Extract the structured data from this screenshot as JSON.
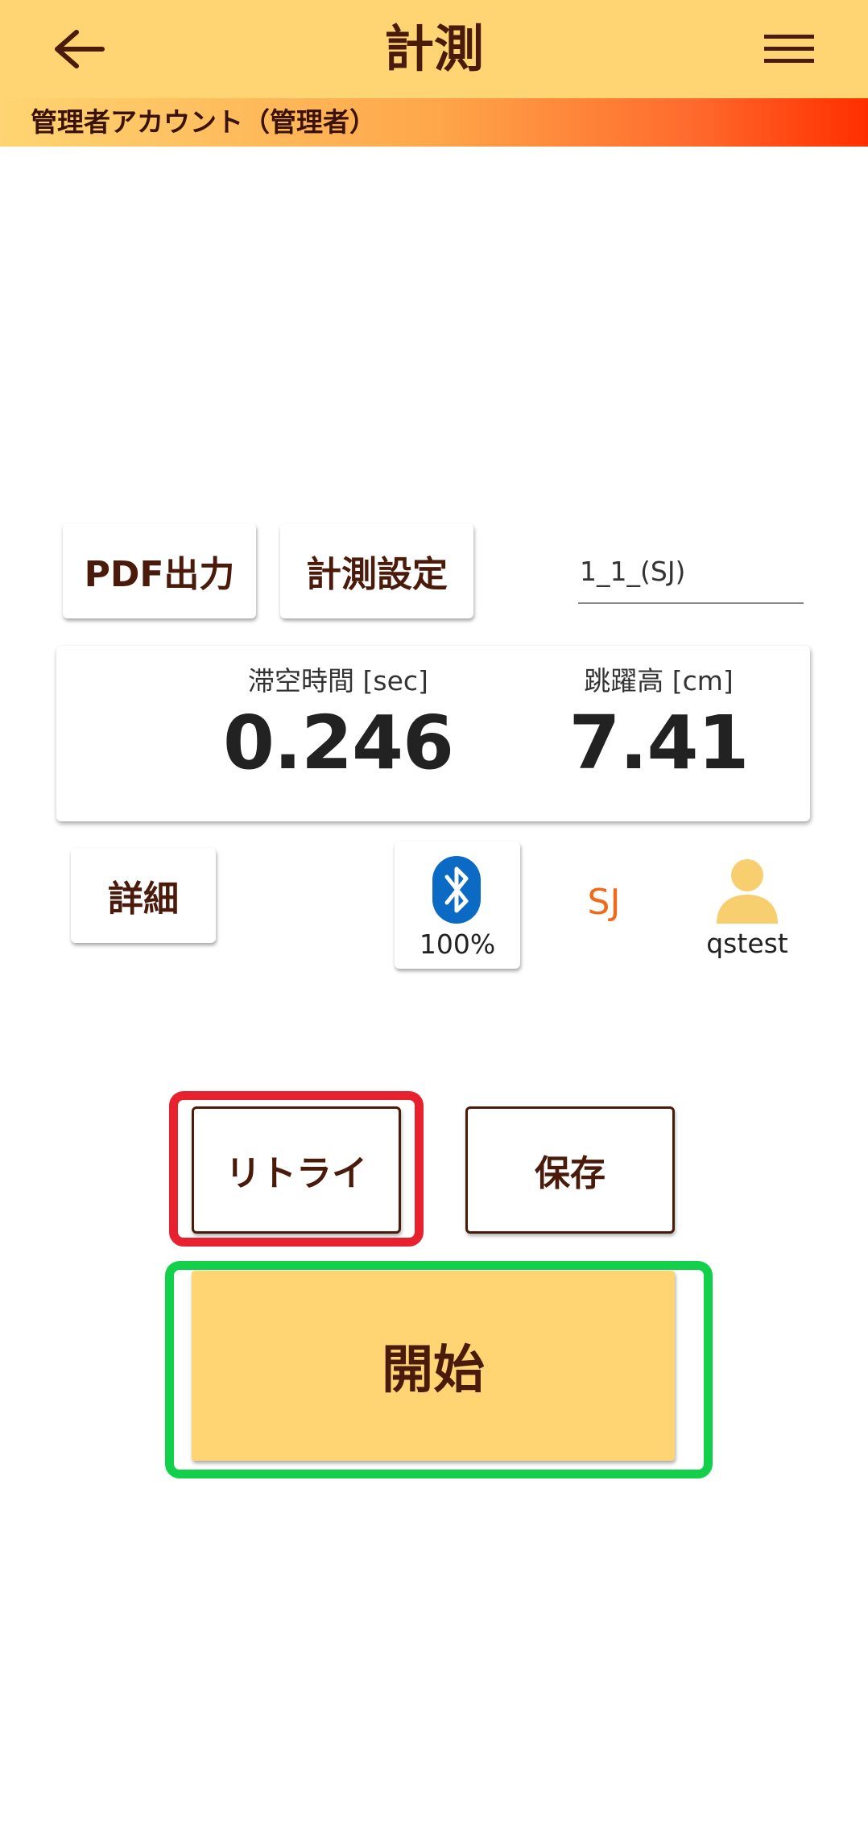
{
  "header": {
    "title": "計測",
    "back_icon": "arrow-left-icon",
    "menu_icon": "hamburger-menu-icon",
    "background_color": "#fed572"
  },
  "account": {
    "label": "管理者アカウント（管理者）"
  },
  "toolbar": {
    "pdf_label": "PDF出力",
    "settings_label": "計測設定",
    "file_name_value": "1_1_(SJ)"
  },
  "results": {
    "airtime_label": "滞空時間 [sec]",
    "airtime_value": "0.246",
    "jump_height_label": "跳躍高 [cm]",
    "jump_height_value": "7.41"
  },
  "status": {
    "detail_label": "詳細",
    "bluetooth_icon": "bluetooth-icon",
    "battery_percent": "100%",
    "mode": "SJ",
    "user_icon": "user-icon",
    "user_name": "qstest"
  },
  "actions": {
    "retry_label": "リトライ",
    "save_label": "保存",
    "start_label": "開始"
  },
  "colors": {
    "accent": "#fed572",
    "text_dark": "#4a1a0a",
    "mode_color": "#f06a1a",
    "bluetooth_color": "#0b6ac4",
    "highlight_red": "#e8212f",
    "highlight_green": "#12d04a"
  }
}
